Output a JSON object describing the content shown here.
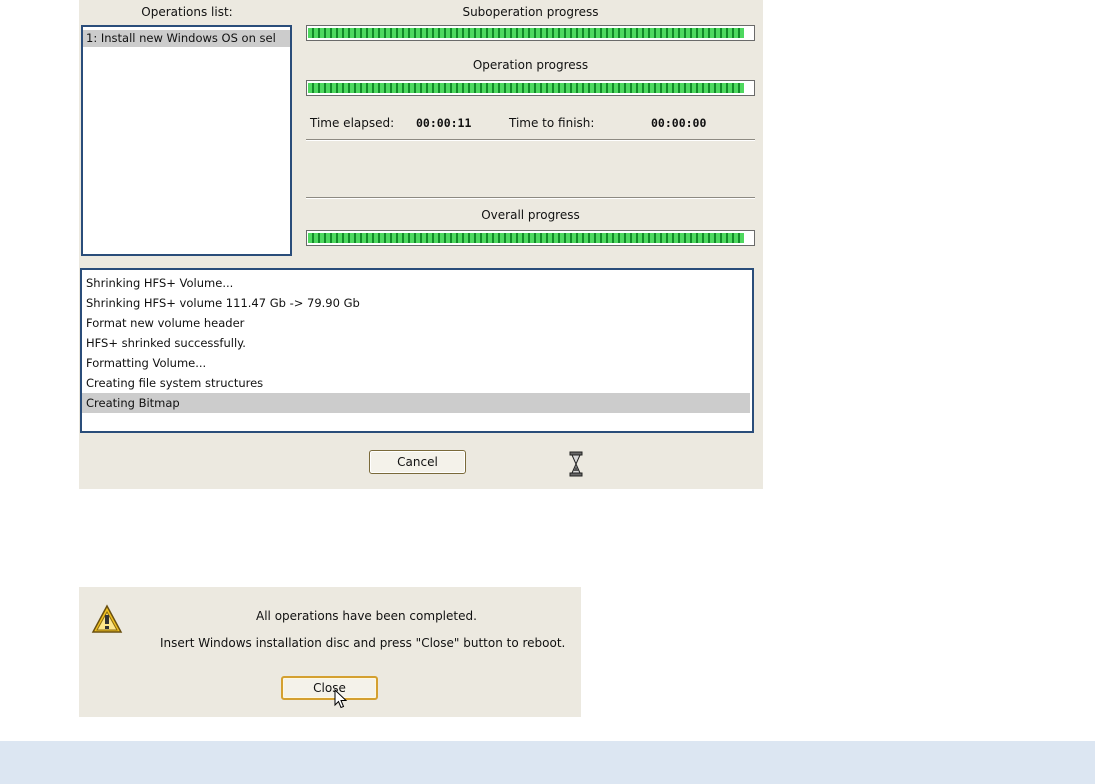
{
  "progress_window": {
    "operations_list_label": "Operations list:",
    "operations": [
      {
        "label": "1: Install new Windows OS on sel"
      }
    ],
    "suboperation": {
      "label": "Suboperation progress",
      "percent": 98
    },
    "operation": {
      "label": "Operation progress",
      "percent": 98
    },
    "time_elapsed_label": "Time elapsed:",
    "time_elapsed_value": "00:00:11",
    "time_to_finish_label": "Time to finish:",
    "time_to_finish_value": "00:00:00",
    "overall": {
      "label": "Overall progress",
      "percent": 98
    },
    "log": [
      "Shrinking HFS+ Volume...",
      "Shrinking HFS+ volume 111.47 Gb -> 79.90 Gb",
      "Format new volume header",
      "HFS+ shrinked successfully.",
      "Formatting Volume...",
      "Creating file system structures",
      "Creating Bitmap"
    ],
    "log_selected_index": 6,
    "cancel_label": "Cancel",
    "busy_icon": "hourglass-icon"
  },
  "completion_dialog": {
    "icon": "warning-icon",
    "line1": "All operations have been completed.",
    "line2": "Insert Windows installation disc and press \"Close\" button to reboot.",
    "close_label": "Close",
    "cursor_icon": "mouse-pointer-icon"
  },
  "colors": {
    "panel_bg": "#ece9e0",
    "progress_green": "#1fb23a",
    "list_border": "#2a4d7a",
    "footer_band": "#dce6f2"
  }
}
